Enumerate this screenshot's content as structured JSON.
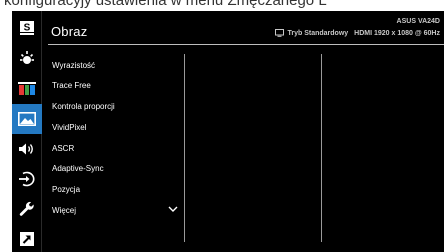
{
  "caption": "konfiguracyjy ustawienia w menu Zmęczanego L",
  "header": {
    "title": "Obraz",
    "model": "ASUS VA24D",
    "mode": "Tryb Standardowy",
    "signal": "HDMI 1920 x 1080 @ 60Hz"
  },
  "sidebar": {
    "items": [
      {
        "icon": "splendid-icon",
        "label": "S",
        "active": false
      },
      {
        "icon": "blue-light-icon",
        "active": false
      },
      {
        "icon": "color-bars-icon",
        "active": false
      },
      {
        "icon": "image-icon",
        "active": true
      },
      {
        "icon": "speaker-icon",
        "active": false
      },
      {
        "icon": "input-select-icon",
        "active": false
      },
      {
        "icon": "wrench-icon",
        "active": false
      },
      {
        "icon": "shortcut-icon",
        "active": false
      }
    ]
  },
  "menu": {
    "items": [
      "Wyrazistość",
      "Trace Free",
      "Kontrola proporcji",
      "VividPixel",
      "ASCR",
      "Adaptive-Sync",
      "Pozycja",
      "Więcej"
    ],
    "more_icon": "chevron-down-icon"
  },
  "colors": {
    "background": "#000000",
    "active_accent": "#2479c2",
    "text": "#ffffff",
    "divider": "#9a9a9a"
  }
}
